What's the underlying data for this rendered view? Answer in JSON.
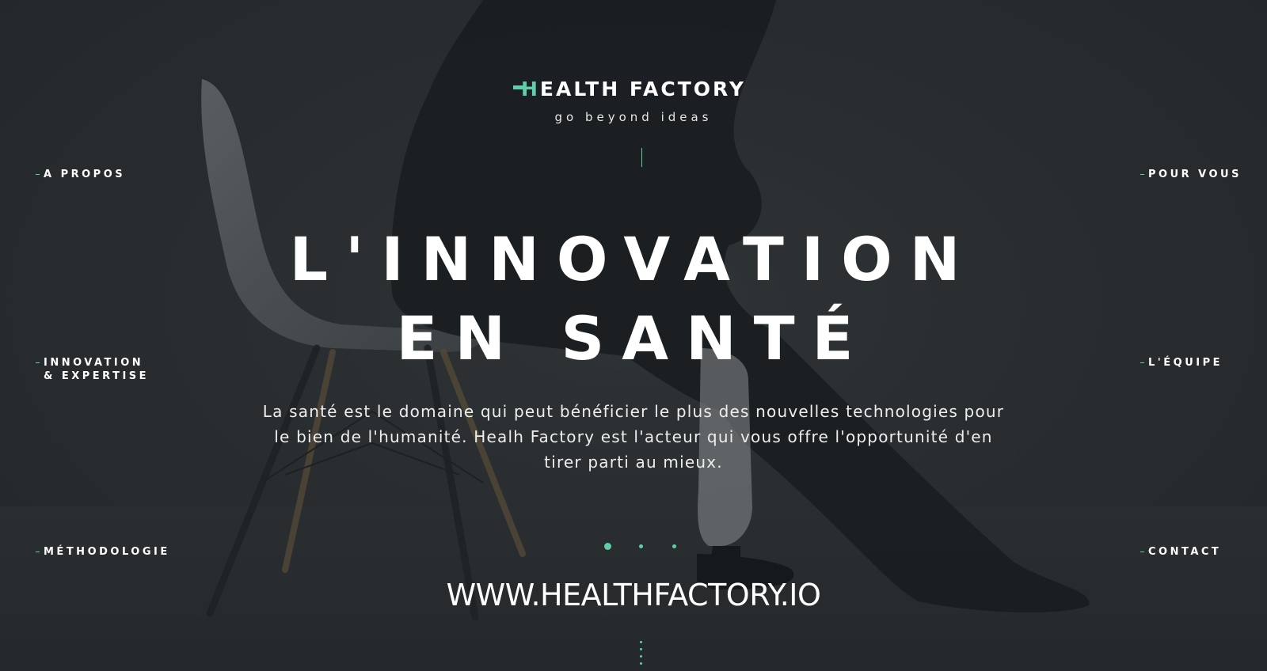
{
  "brand": {
    "name_accent": "H",
    "name_rest": "EALTH FACTORY",
    "tagline": "go beyond ideas",
    "accent_color": "#5ecfa8"
  },
  "nav": {
    "left": [
      {
        "label": "A PROPOS"
      },
      {
        "label": "INNOVATION",
        "label2": "& EXPERTISE"
      },
      {
        "label": "MÉTHODOLOGIE"
      }
    ],
    "right": [
      {
        "label": "POUR VOUS"
      },
      {
        "label": "L'ÉQUIPE"
      },
      {
        "label": "CONTACT"
      }
    ]
  },
  "hero": {
    "headline_line1": "L'INNOVATION",
    "headline_line2": "EN SANTÉ",
    "description": "La santé est le domaine qui peut bénéficier le plus des nouvelles technologies pour le bien de l'humanité. Healh Factory est l'acteur qui vous offre l'opportunité d'en tirer parti au mieux.",
    "url": "WWW.HEALTHFACTORY.IO"
  },
  "carousel": {
    "slide_count": 3,
    "active_slide": 1
  },
  "icons": {
    "logo_mark": "cross-h-icon",
    "scroll_indicator": "scroll-down-dots-icon"
  }
}
